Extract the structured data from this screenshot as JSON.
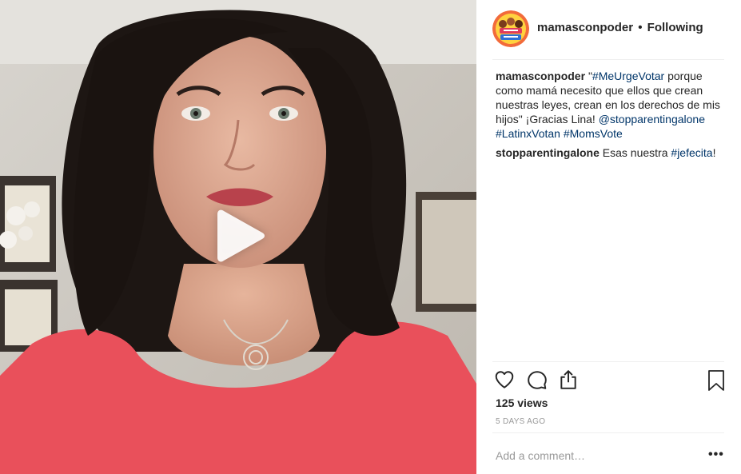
{
  "post": {
    "author": "mamasconpoder",
    "separator": "•",
    "follow_status": "Following",
    "avatar_label": "MAMÁS CON PODER"
  },
  "caption": {
    "user": "mamasconpoder",
    "parts": {
      "p1": "\"",
      "tag1": "#MeUrgeVotar",
      "p2": " porque como mamá necesito que ellos que crean nuestras leyes, crean en los derechos de mis hijos\" ¡Gracias Lina! ",
      "mention": "@stopparentingalone",
      "p3": " ",
      "tag2": "#LatinxVotan",
      "p4": " ",
      "tag3": "#MomsVote"
    }
  },
  "reply": {
    "user": "stopparentingalone",
    "text": "Esas nuestra ",
    "tag": "#jefecita",
    "end": "!"
  },
  "stats": {
    "views": "125 views",
    "date": "5 DAYS AGO"
  },
  "comment_box": {
    "placeholder": "Add a comment…",
    "more": "•••"
  },
  "icons": {
    "heart": "heart-icon",
    "comment": "comment-icon",
    "share": "share-icon",
    "save": "bookmark-icon",
    "play": "play-icon"
  },
  "colors": {
    "link": "#003569",
    "text": "#262626",
    "muted": "#999999",
    "divider": "#efefef"
  }
}
